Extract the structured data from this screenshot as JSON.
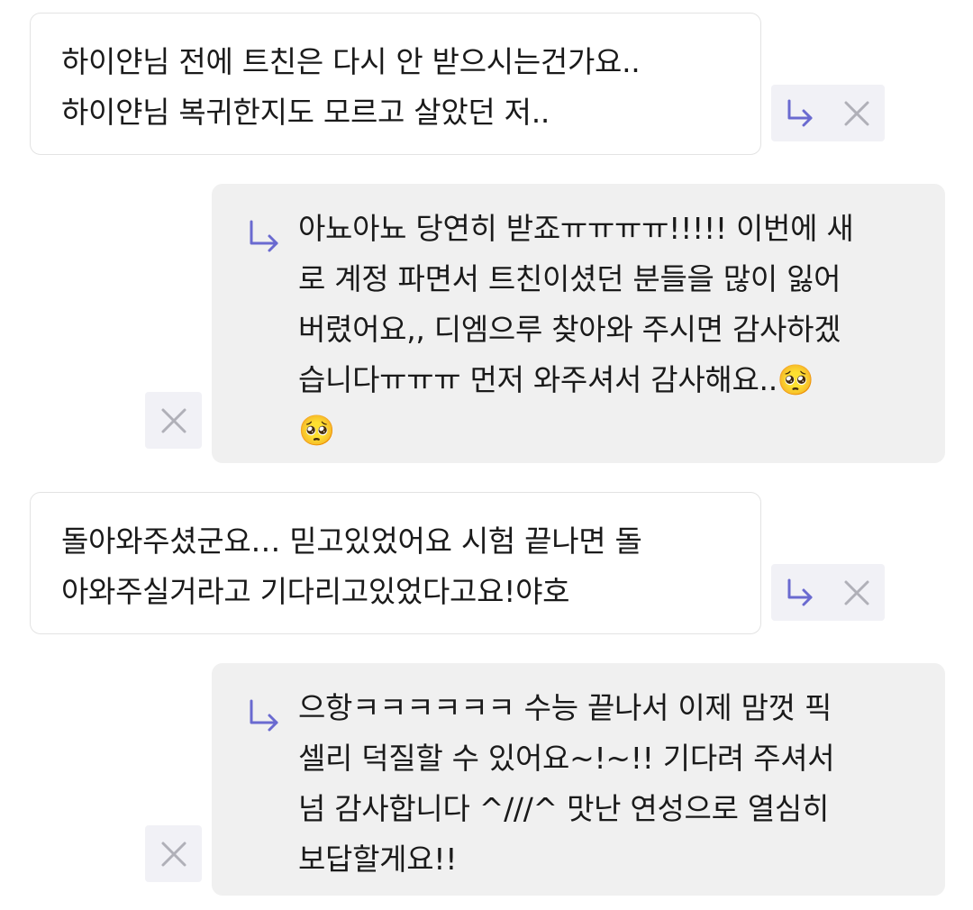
{
  "colors": {
    "reply_accent": "#6a6ad0",
    "close_gray": "#b0b0b8",
    "incoming_bg": "#ffffff",
    "outgoing_bg": "#f0f0f0",
    "action_bg": "#f1f1f6"
  },
  "messages": [
    {
      "type": "incoming",
      "text": "하이얀님 전에 트친은 다시 안 받으시는건가요..\n하이얀님 복귀한지도 모르고 살았던 저..",
      "actions": [
        "reply-icon",
        "close-icon"
      ]
    },
    {
      "type": "outgoing",
      "text": "아뇨아뇨 당연히 받죠ㅠㅠㅠㅠ!!!!! 이번에 새\n로 계정 파면서 트친이셨던 분들을 많이 잃어\n버렸어요,, 디엠으루 찾아와 주시면 감사하겠\n습니다ㅠㅠㅠ 먼저 와주셔서 감사해요..🥺\n🥺",
      "actions": [
        "close-icon"
      ]
    },
    {
      "type": "incoming",
      "text": "돌아와주셨군요… 믿고있었어요 시험 끝나면 돌\n아와주실거라고 기다리고있었다고요!야호",
      "actions": [
        "reply-icon",
        "close-icon"
      ]
    },
    {
      "type": "outgoing",
      "text": "으항ㅋㅋㅋㅋㅋㅋ 수능 끝나서 이제 맘껏 픽\n셀리 덕질할 수 있어요~!~!! 기다려 주셔서\n넘 감사합니다 ^///^ 맛난 연성으로 열심히\n보답할게요!!",
      "actions": [
        "close-icon"
      ]
    }
  ]
}
